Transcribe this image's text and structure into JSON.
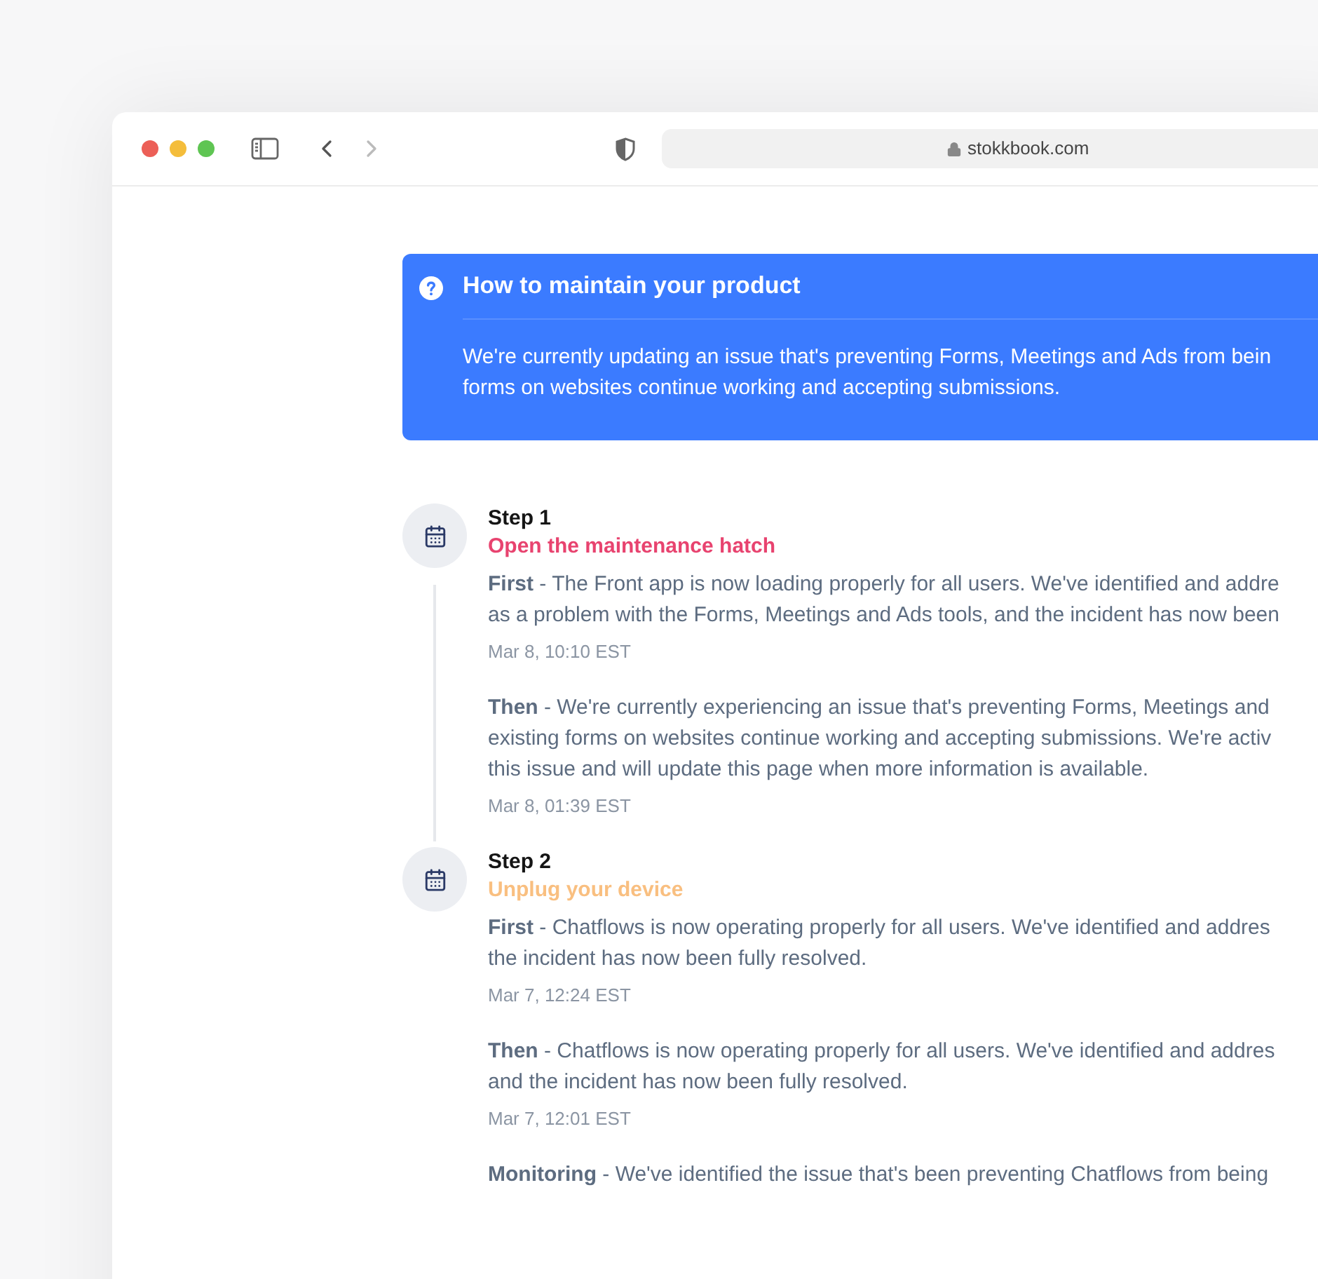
{
  "browser": {
    "url": "stokkbook.com"
  },
  "banner": {
    "title": "How to maintain your product",
    "lines": [
      "We're currently updating an issue that's preventing Forms, Meetings and Ads from bein",
      "forms on websites continue working and accepting submissions."
    ]
  },
  "steps": [
    {
      "label": "Step 1",
      "subtitle": "Open the maintenance hatch",
      "color": "#e8436f",
      "updates": [
        {
          "lines": [
            "**First** - The Front app is now loading properly for all users. We've identified and addre",
            "as a problem with the Forms, Meetings and Ads tools, and the incident has now been"
          ],
          "time": "Mar 8, 10:10 EST"
        },
        {
          "lines": [
            "**Then** - We're currently experiencing an issue that's preventing Forms, Meetings and",
            "existing forms on websites continue working and accepting submissions. We're activ",
            "this issue and will update this page when more information is available."
          ],
          "time": "Mar 8, 01:39 EST"
        }
      ]
    },
    {
      "label": "Step 2",
      "subtitle": "Unplug your device",
      "color": "#f9bf80",
      "updates": [
        {
          "lines": [
            "**First** - Chatflows is now operating properly for all users. We've identified and addres",
            "the incident has now been fully resolved."
          ],
          "time": "Mar 7, 12:24 EST"
        },
        {
          "lines": [
            "**Then** - Chatflows is now operating properly for all users. We've identified and addres",
            "and the incident has now been fully resolved."
          ],
          "time": "Mar 7, 12:01 EST"
        },
        {
          "lines": [
            "**Monitoring** - We've identified the issue that's been preventing Chatflows from being"
          ]
        }
      ]
    }
  ]
}
